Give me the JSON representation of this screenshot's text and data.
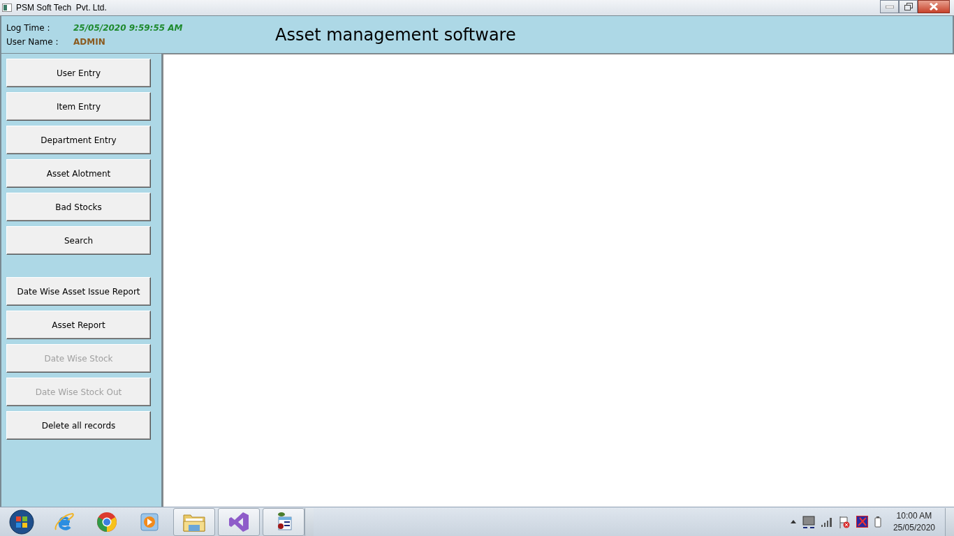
{
  "window": {
    "title": "PSM Soft Tech  Pvt. Ltd."
  },
  "header": {
    "log_time_label": "Log Time :",
    "log_time": "25/05/2020 9:59:55 AM",
    "user_name_label": "User Name :",
    "user_name": "ADMIN",
    "app_title": "Asset management software"
  },
  "sidebar": {
    "groups": [
      {
        "items": [
          {
            "label": "User Entry",
            "disabled": false
          },
          {
            "label": "Item Entry",
            "disabled": false
          },
          {
            "label": "Department Entry",
            "disabled": false
          },
          {
            "label": "Asset Alotment",
            "disabled": false
          },
          {
            "label": "Bad Stocks",
            "disabled": false
          },
          {
            "label": "Search",
            "disabled": false
          }
        ]
      },
      {
        "items": [
          {
            "label": "Date Wise Asset Issue Report",
            "disabled": false
          },
          {
            "label": "Asset Report",
            "disabled": false
          },
          {
            "label": "Date Wise Stock",
            "disabled": true
          },
          {
            "label": "Date Wise Stock Out",
            "disabled": true
          },
          {
            "label": "Delete all records",
            "disabled": false
          }
        ]
      }
    ]
  },
  "taskbar": {
    "clock_time": "10:00 AM",
    "clock_date": "25/05/2020"
  }
}
